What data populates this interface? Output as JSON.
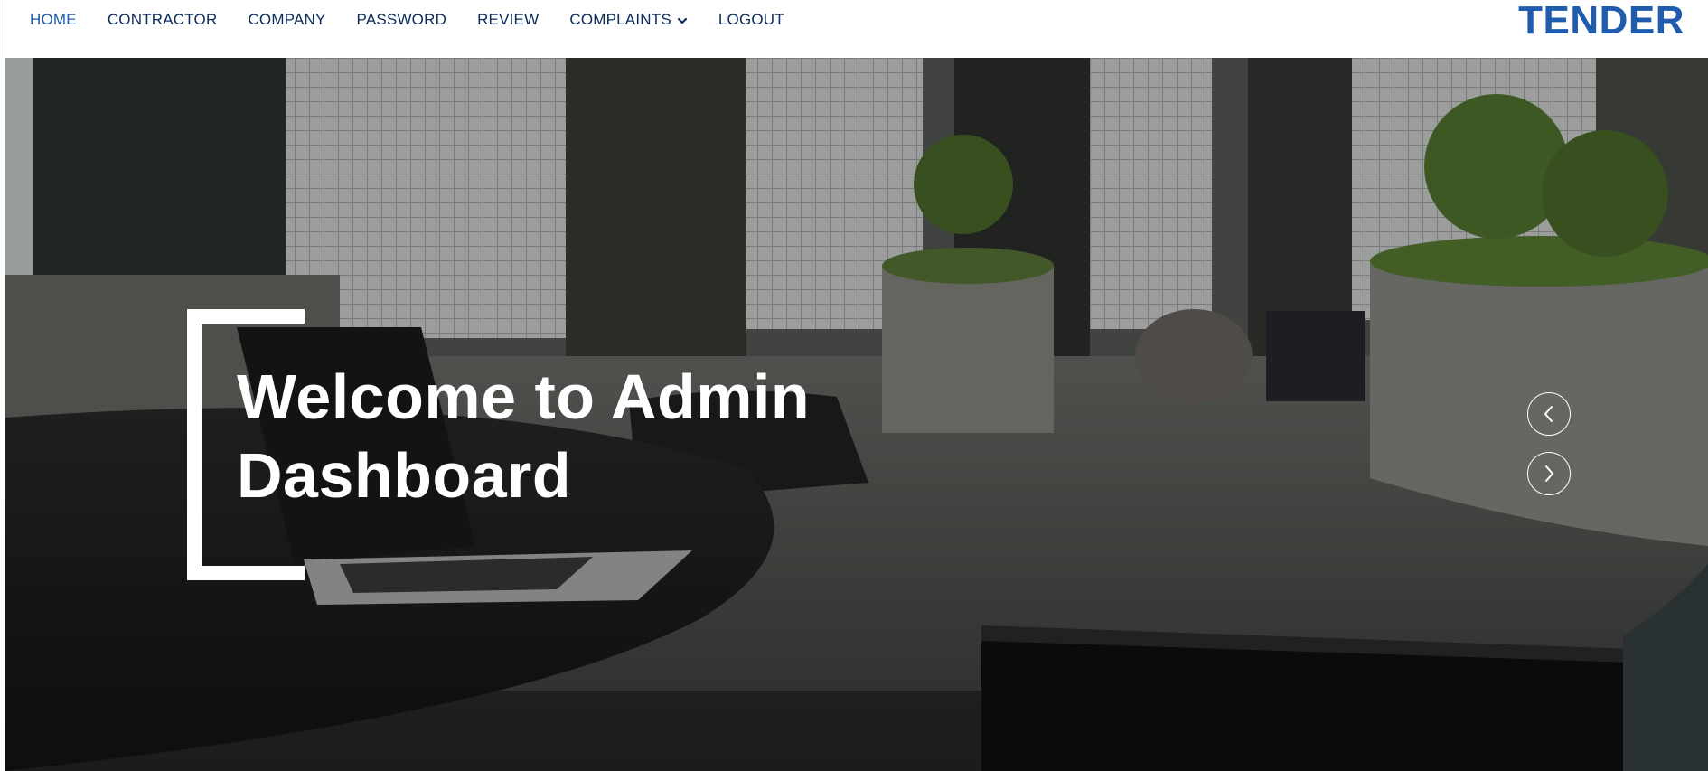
{
  "nav": {
    "items": [
      {
        "label": "HOME",
        "active": true
      },
      {
        "label": "CONTRACTOR",
        "active": false
      },
      {
        "label": "COMPANY",
        "active": false
      },
      {
        "label": "PASSWORD",
        "active": false
      },
      {
        "label": "REVIEW",
        "active": false
      },
      {
        "label": "COMPLAINTS",
        "active": false,
        "dropdown": true
      },
      {
        "label": "LOGOUT",
        "active": false
      }
    ]
  },
  "brand": {
    "name": "TENDER"
  },
  "hero": {
    "title_line1": "Welcome to Admin",
    "title_line2": "Dashboard",
    "prev_icon": "chevron-left-icon",
    "next_icon": "chevron-right-icon"
  },
  "colors": {
    "nav_text": "#0c2c5c",
    "nav_active": "#1f5cad",
    "brand": "#1f5cad",
    "hero_text": "#ffffff"
  }
}
